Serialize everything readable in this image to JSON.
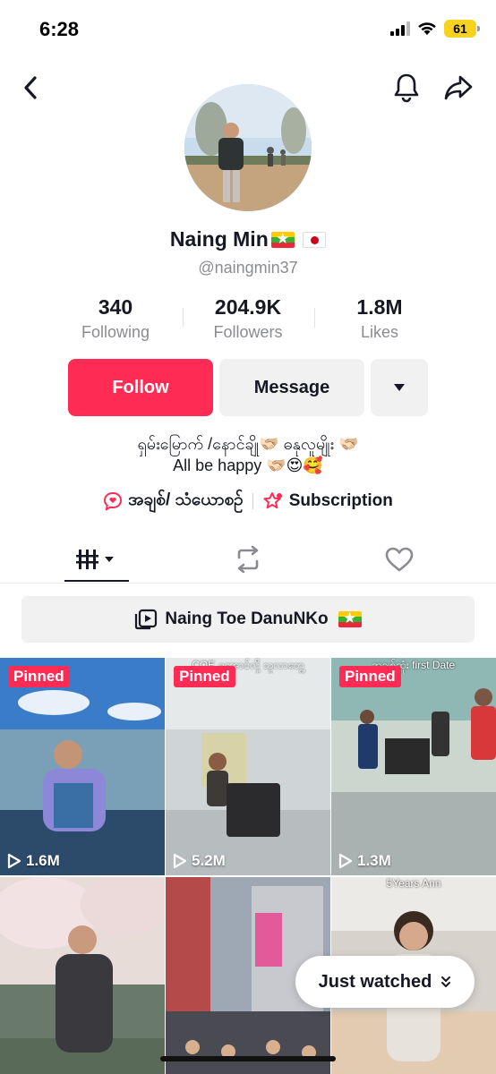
{
  "status_bar": {
    "time": "6:28",
    "battery": "61"
  },
  "profile": {
    "name": "Naing Min",
    "handle": "@naingmin37",
    "stats": [
      {
        "value": "340",
        "label": "Following"
      },
      {
        "value": "204.9K",
        "label": "Followers"
      },
      {
        "value": "1.8M",
        "label": "Likes"
      }
    ],
    "buttons": {
      "follow": "Follow",
      "message": "Message"
    },
    "bio_line1": "ရှမ်းမြောက် /နောင်ချို🫱🏻‍🫲🏼   ဓနုလူမျိုး 🫱🏻‍🫲🏼",
    "bio_line2": "All be happy 🫱🏻‍🫲🏼😍🥰",
    "links": [
      {
        "label": "အချစ်/ သံယောစဉ်"
      },
      {
        "label": "Subscription"
      }
    ]
  },
  "playlist": {
    "label": "Naing Toe DanuNKo"
  },
  "videos": [
    {
      "pinned": "Pinned",
      "views": "1.6M",
      "caption": ""
    },
    {
      "pinned": "Pinned",
      "views": "5.2M",
      "caption": "COE ရအောင်လို့ သူလာတွေ့"
    },
    {
      "pinned": "Pinned",
      "views": "1.3M",
      "caption": "အချစ်ဆုံး first Date"
    },
    {
      "pinned": "",
      "views": "",
      "caption": ""
    },
    {
      "pinned": "",
      "views": "",
      "caption": ""
    },
    {
      "pinned": "",
      "views": "",
      "caption": "5Years Ann"
    }
  ],
  "just_watched": {
    "label": "Just watched"
  },
  "colors": {
    "accent": "#fe2c55",
    "text": "#161823",
    "muted": "#8a8b91",
    "chip": "#f1f1f2"
  }
}
